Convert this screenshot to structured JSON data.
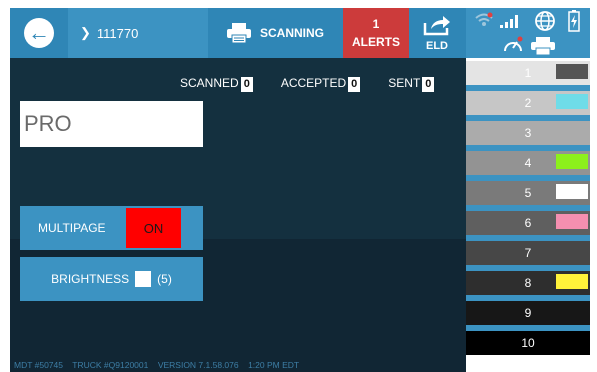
{
  "topbar": {
    "doc_number": "111770",
    "scan_label": "SCANNING",
    "alerts_count": "1",
    "alerts_label": "ALERTS",
    "eld_label": "ELD"
  },
  "stats": {
    "scanned_label": "SCANNED",
    "scanned_value": "0",
    "accepted_label": "ACCEPTED",
    "accepted_value": "0",
    "sent_label": "SENT",
    "sent_value": "0"
  },
  "pro_input": {
    "placeholder": "PRO",
    "value": ""
  },
  "multipage": {
    "label": "MULTIPAGE",
    "state": "ON"
  },
  "brightness": {
    "label": "BRIGHTNESS",
    "value": "(5)"
  },
  "footer": {
    "mdt": "MDT #50745",
    "truck": "TRUCK #Q9120001",
    "version": "VERSION  7.1.58.076",
    "time": "1:20 PM EDT"
  },
  "swatches": [
    {
      "label": "1",
      "bg": "#e4e4e4",
      "text": "#ffffff",
      "mark": "#555555"
    },
    {
      "label": "2",
      "bg": "#c6c6c6",
      "text": "#ffffff",
      "mark": "#6fdce8"
    },
    {
      "label": "3",
      "bg": "#ababab",
      "text": "#ffffff",
      "mark": null
    },
    {
      "label": "4",
      "bg": "#939393",
      "text": "#ffffff",
      "mark": "#8cf01c"
    },
    {
      "label": "5",
      "bg": "#7a7a7a",
      "text": "#ffffff",
      "mark": "#ffffff"
    },
    {
      "label": "6",
      "bg": "#5f5f5f",
      "text": "#ffffff",
      "mark": "#f58fb0"
    },
    {
      "label": "7",
      "bg": "#474747",
      "text": "#ffffff",
      "mark": null
    },
    {
      "label": "8",
      "bg": "#2e2e2e",
      "text": "#ffffff",
      "mark": "#fff23a"
    },
    {
      "label": "9",
      "bg": "#171717",
      "text": "#ffffff",
      "mark": null
    },
    {
      "label": "10",
      "bg": "#000000",
      "text": "#ffffff",
      "mark": null
    }
  ],
  "colors": {
    "header": "#2f86b6",
    "header_light": "#3c93c2",
    "alert": "#cc3b3b",
    "background": "#14303f",
    "toggle_on": "#ff0000"
  }
}
